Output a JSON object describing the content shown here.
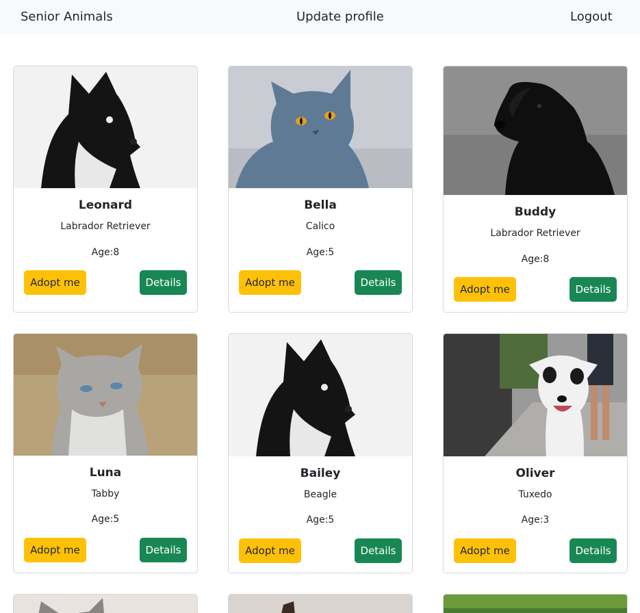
{
  "nav": {
    "brand": "Senior Animals",
    "update_profile": "Update profile",
    "logout": "Logout"
  },
  "animals": [
    {
      "name": "Leonard",
      "breed": "Labrador Retriever",
      "age": "Age:8",
      "adopt_label": "Adopt me",
      "details_label": "Details",
      "image": "black-husky-dog"
    },
    {
      "name": "Bella",
      "breed": "Calico",
      "age": "Age:5",
      "adopt_label": "Adopt me",
      "details_label": "Details",
      "image": "blue-gray-cat"
    },
    {
      "name": "Buddy",
      "breed": "Labrador Retriever",
      "age": "Age:8",
      "adopt_label": "Adopt me",
      "details_label": "Details",
      "image": "black-labrador"
    },
    {
      "name": "Luna",
      "breed": "Tabby",
      "age": "Age:5",
      "adopt_label": "Adopt me",
      "details_label": "Details",
      "image": "gray-tabby-cat"
    },
    {
      "name": "Bailey",
      "breed": "Beagle",
      "age": "Age:5",
      "adopt_label": "Adopt me",
      "details_label": "Details",
      "image": "black-husky-dog"
    },
    {
      "name": "Oliver",
      "breed": "Tuxedo",
      "age": "Age:3",
      "adopt_label": "Adopt me",
      "details_label": "Details",
      "image": "spotted-dog-walking"
    }
  ],
  "colors": {
    "navbar_bg": "#f8f9fa",
    "adopt_button": "#ffc107",
    "details_button": "#198754",
    "card_border": "#d6d8da"
  }
}
